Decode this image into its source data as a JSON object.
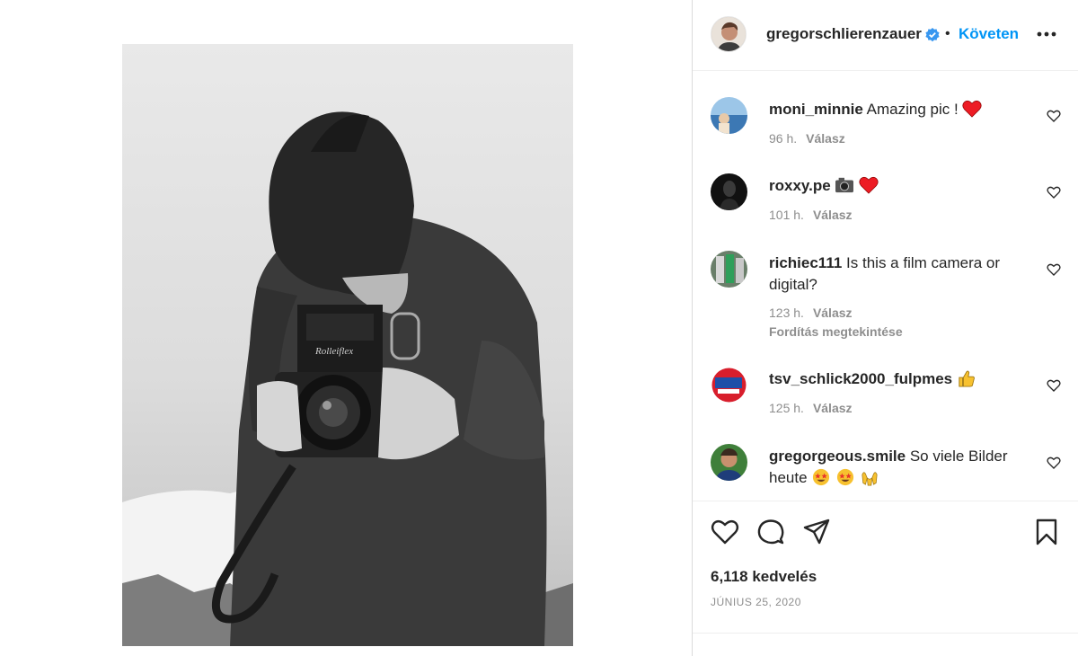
{
  "post": {
    "author": "gregorschlierenzauer",
    "follow_label": "Követen",
    "separator": "•",
    "likes": "6,118 kedvelés",
    "date": "JÚNIUS 25, 2020",
    "verified": true
  },
  "photo": {
    "camera_brand": "Rolleiflex"
  },
  "comments": [
    {
      "user": "moni_minnie",
      "text": "Amazing pic ! ",
      "emoji": "red-heart",
      "time": "96 h.",
      "reply": "Válasz"
    },
    {
      "user": "roxxy.pe",
      "text": "",
      "emoji": "camera, red-heart",
      "time": "101 h.",
      "reply": "Válasz"
    },
    {
      "user": "richiec111",
      "text": "Is this a film camera or digital?",
      "time": "123 h.",
      "reply": "Válasz",
      "translate": "Fordítás megtekintése"
    },
    {
      "user": "tsv_schlick2000_fulpmes",
      "text": "",
      "emoji": "thumbs-up",
      "time": "125 h.",
      "reply": "Válasz"
    },
    {
      "user": "gregorgeous.smile",
      "text": "So viele Bilder heute",
      "emoji": "star-struck, star-struck, raising-hands"
    }
  ],
  "icons": {
    "like": "heart-icon",
    "comment": "comment-icon",
    "share": "share-icon",
    "save": "bookmark-icon",
    "more": "more-icon"
  },
  "colors": {
    "link_blue": "#0095f6",
    "verified_blue": "#3897f0",
    "heart_red": "#ed1c24",
    "meta_gray": "#8e8e8e"
  }
}
